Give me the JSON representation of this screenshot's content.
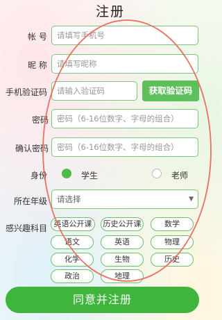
{
  "title": "注册",
  "account": {
    "label": "帐 号",
    "placeholder": "请填写手机号"
  },
  "nickname": {
    "label": "昵 称",
    "placeholder": "请填写昵称"
  },
  "sms": {
    "label": "手机验证码",
    "placeholder": "请输入验证码",
    "button": "获取验证码"
  },
  "password": {
    "label": "密码",
    "placeholder": "密码（6-16位数字、字母的组合）"
  },
  "confirm_password": {
    "label": "确认密码",
    "placeholder": "密码（6-16位数字、字母的组合）"
  },
  "identity": {
    "label": "身份",
    "options": [
      {
        "label": "学生",
        "selected": true
      },
      {
        "label": "老师",
        "selected": false
      }
    ]
  },
  "grade": {
    "label": "所在年级",
    "value": "请选择"
  },
  "interests": {
    "label": "感兴趣科目",
    "tags": [
      "英语公开课",
      "历史公开课",
      "数学",
      "语文",
      "英语",
      "物理",
      "化学",
      "生物",
      "历史",
      "政治",
      "地理"
    ]
  },
  "submit_label": "同意并注册",
  "colors": {
    "accent": "#3fb53c",
    "border": "#7bc67a",
    "annotation": "#e8705f"
  }
}
